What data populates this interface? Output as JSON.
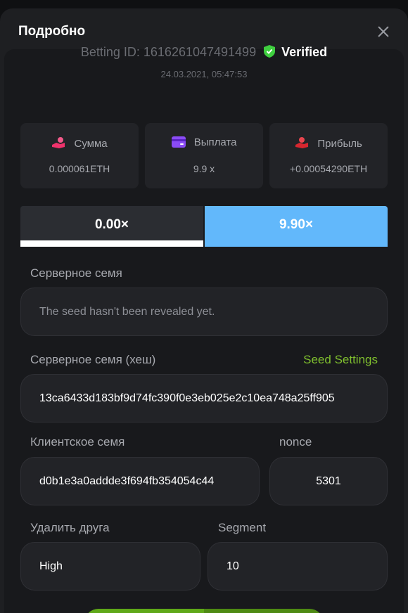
{
  "modal": {
    "title": "Подробно"
  },
  "bet": {
    "id_text": "Betting ID: 1616261047491499",
    "verified": "Verified",
    "date": "24.03.2021, 05:47:53"
  },
  "stats": [
    {
      "label": "Сумма",
      "value": "0.000061ETH",
      "icon": "coins-hand-icon"
    },
    {
      "label": "Выплата",
      "value": "9.9 x",
      "icon": "wallet-card-icon"
    },
    {
      "label": "Прибыль",
      "value": "+0.00054290ETH",
      "icon": "profit-hand-icon"
    }
  ],
  "multipliers": {
    "left": "0.00×",
    "right": "9.90×"
  },
  "server_seed": {
    "label": "Серверное семя",
    "placeholder": "The seed hasn't been revealed yet."
  },
  "server_seed_hash": {
    "label": "Серверное семя (хеш)",
    "link": "Seed Settings",
    "value": "13ca6433d183bf9d74fc390f0e3eb025e2c10ea748a25ff905"
  },
  "client_seed": {
    "label": "Клиентское семя",
    "value": "d0b1e3a0addde3f694fb354054c44"
  },
  "nonce": {
    "label": "nonce",
    "value": "5301"
  },
  "risk": {
    "label": "Удалить друга",
    "value": "High"
  },
  "segment": {
    "label": "Segment",
    "value": "10"
  },
  "colors": {
    "accent_blue": "#62b8fb",
    "accent_green": "#7fbf2e",
    "verified_green": "#3fcf3f"
  }
}
